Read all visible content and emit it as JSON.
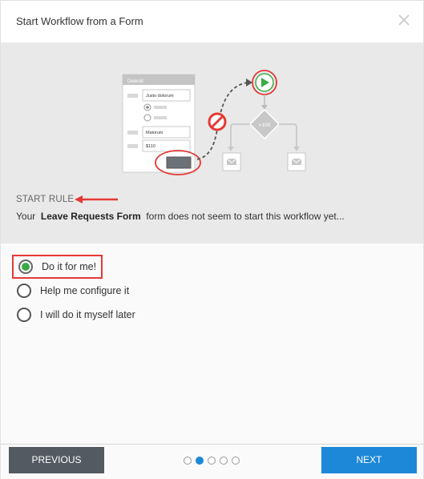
{
  "dialog": {
    "title": "Start Workflow from a Form"
  },
  "illustration": {
    "form_header": "Deleniti",
    "field_1": "Justo dolorum",
    "field_2": "Maiorum",
    "field_3": "$110",
    "condition": ">100"
  },
  "hero": {
    "section_label": "START RULE",
    "message_prefix": "Your",
    "form_name": "Leave Requests Form",
    "message_suffix": "form does not seem to start this workflow yet..."
  },
  "options": [
    {
      "label": "Do it for me!",
      "selected": true
    },
    {
      "label": "Help me configure it",
      "selected": false
    },
    {
      "label": "I will do it myself later",
      "selected": false
    }
  ],
  "footer": {
    "previous_label": "PREVIOUS",
    "next_label": "NEXT",
    "step_count": 5,
    "active_step": 2
  },
  "colors": {
    "accent_blue": "#1d88d8",
    "selected_green": "#3aab47",
    "highlight_red": "#e53935",
    "dark_button": "#545a61"
  }
}
